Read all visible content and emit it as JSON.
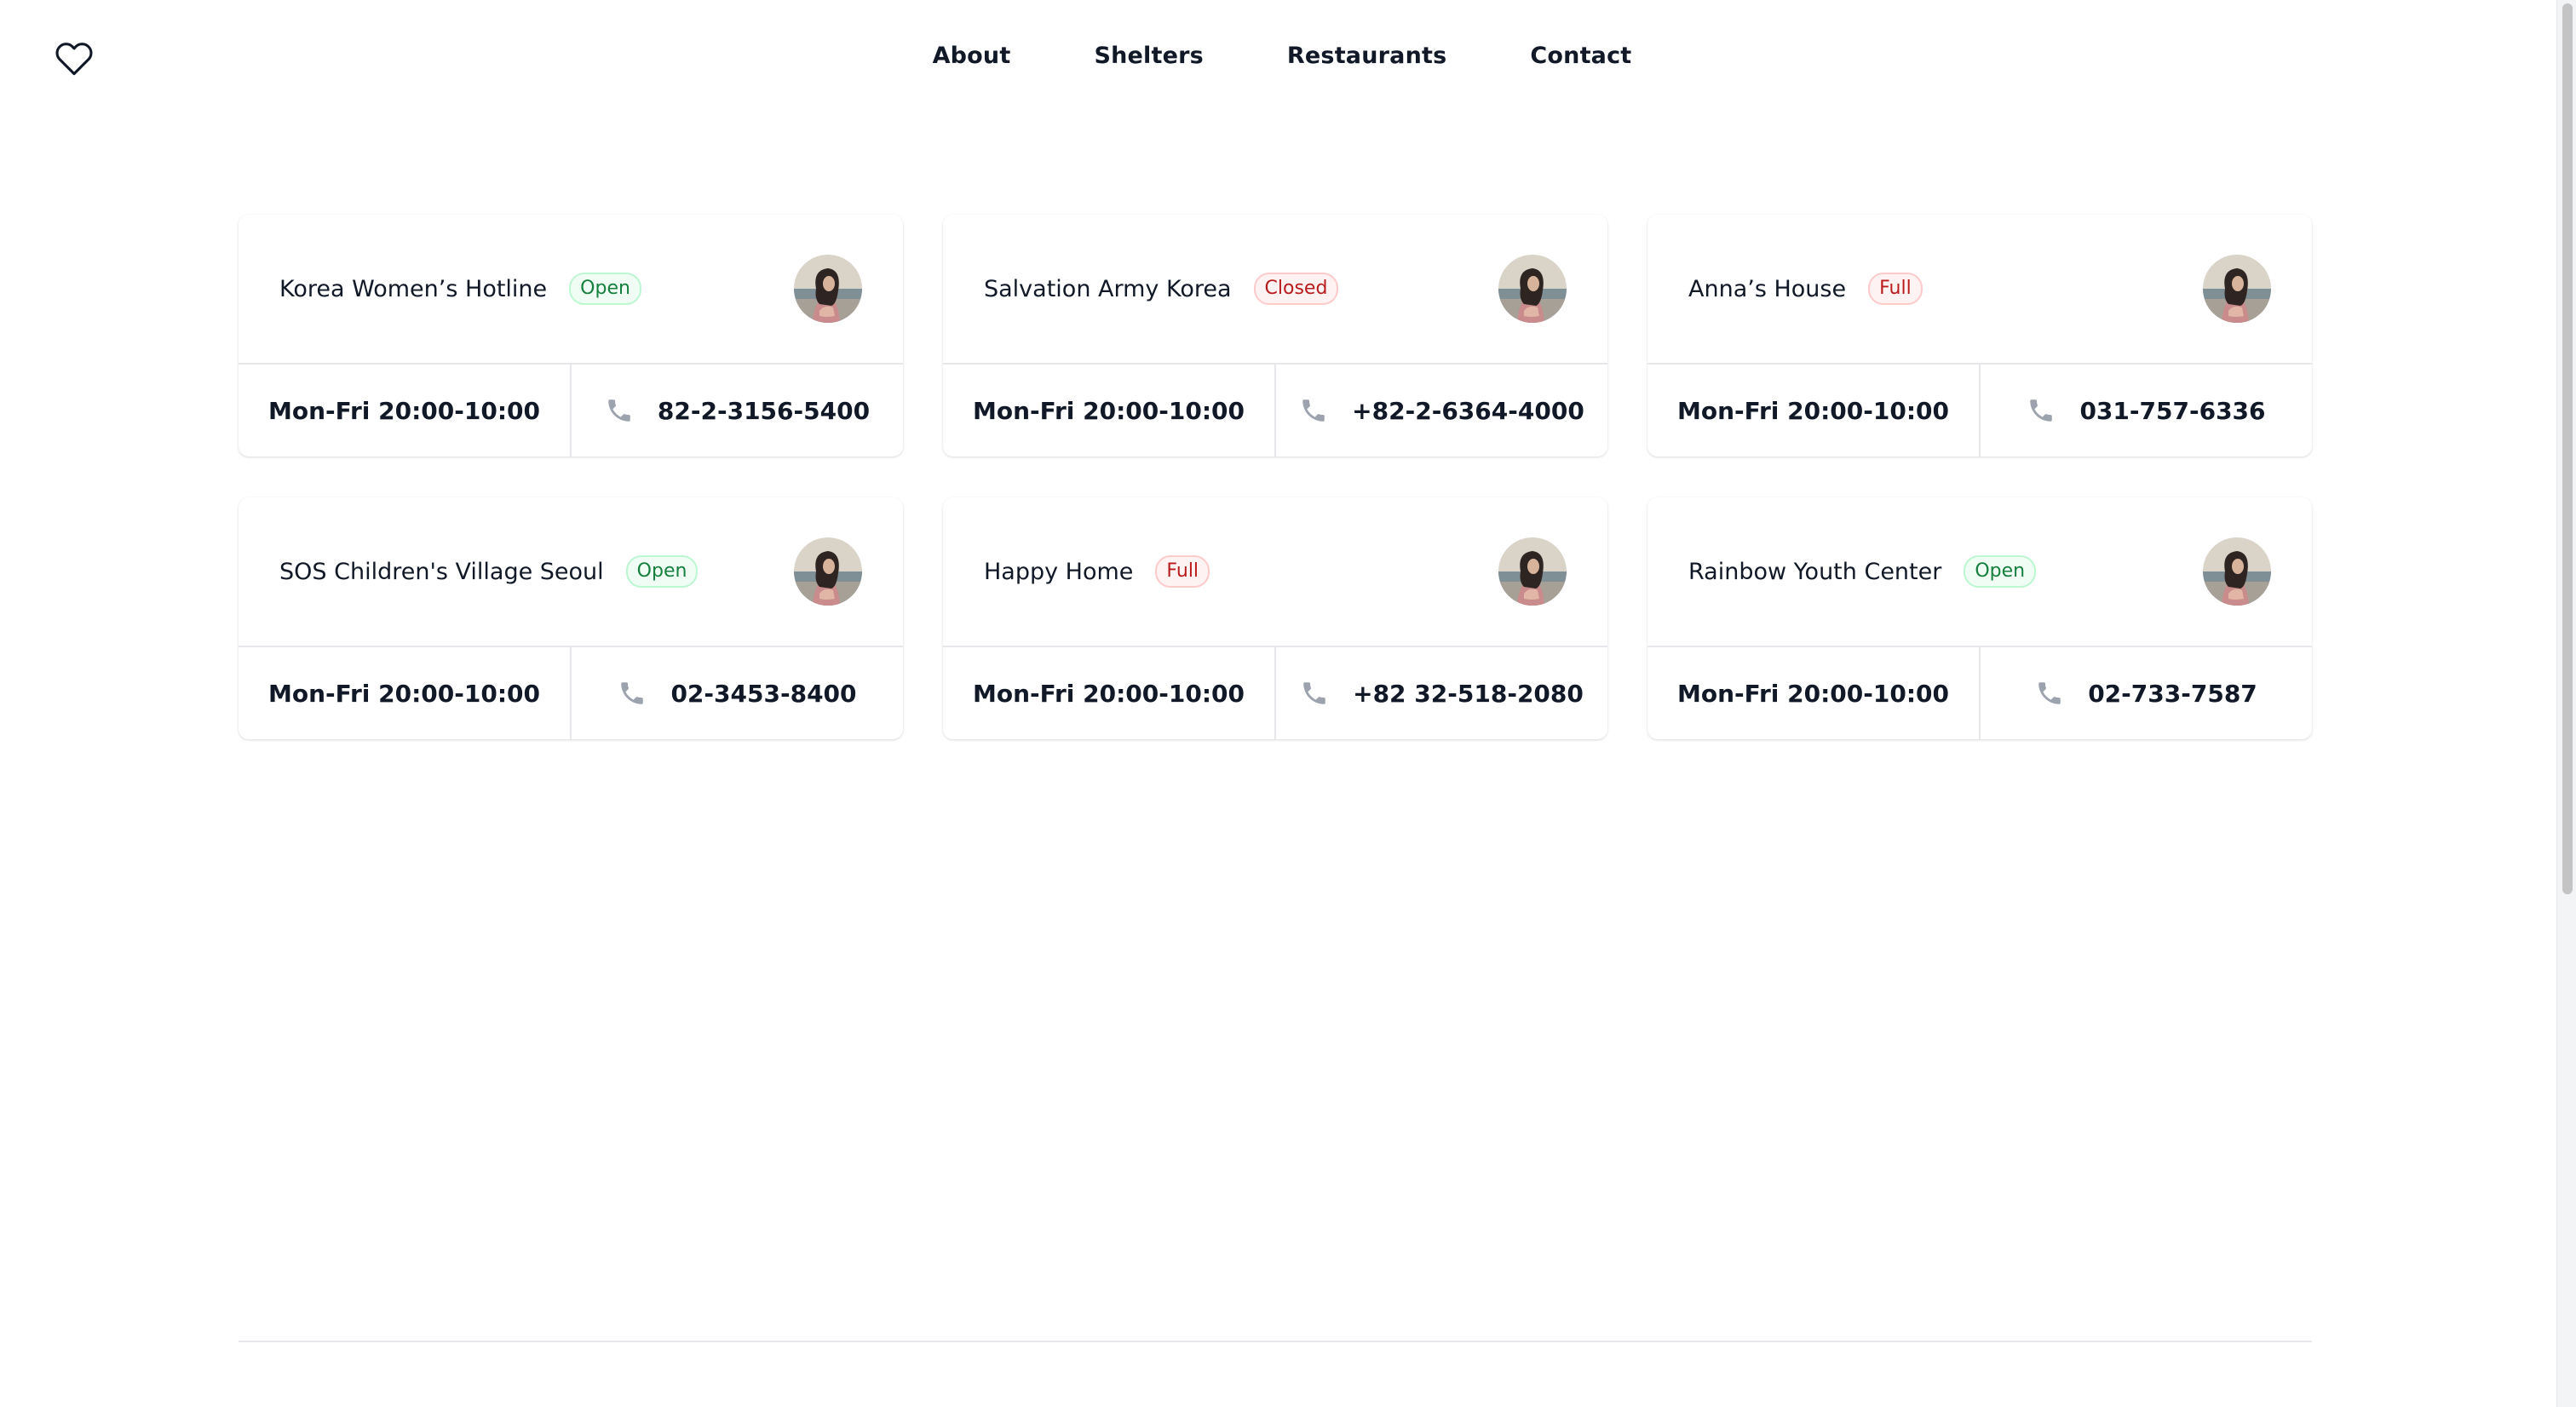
{
  "logo": {
    "icon": "heart-icon"
  },
  "nav": {
    "items": [
      {
        "label": "About"
      },
      {
        "label": "Shelters"
      },
      {
        "label": "Restaurants"
      },
      {
        "label": "Contact"
      }
    ]
  },
  "colors": {
    "open": "#15803d",
    "closed": "#b91c1c",
    "full": "#b91c1c",
    "text": "#111827",
    "border": "#e5e7eb"
  },
  "shelters": [
    {
      "name": "Korea Women’s Hotline",
      "status": "Open",
      "hours": "Mon-Fri 20:00-10:00",
      "phone": "82-2-3156-5400"
    },
    {
      "name": "Salvation Army Korea",
      "status": "Closed",
      "hours": "Mon-Fri 20:00-10:00",
      "phone": "+82-2-6364-4000"
    },
    {
      "name": "Anna’s House",
      "status": "Full",
      "hours": "Mon-Fri 20:00-10:00",
      "phone": "031-757-6336"
    },
    {
      "name": "SOS Children's Village Seoul",
      "status": "Open",
      "hours": "Mon-Fri 20:00-10:00",
      "phone": "02-3453-8400"
    },
    {
      "name": "Happy Home",
      "status": "Full",
      "hours": "Mon-Fri 20:00-10:00",
      "phone": "+82 32-518-2080"
    },
    {
      "name": "Rainbow Youth Center",
      "status": "Open",
      "hours": "Mon-Fri 20:00-10:00",
      "phone": "02-733-7587"
    }
  ]
}
